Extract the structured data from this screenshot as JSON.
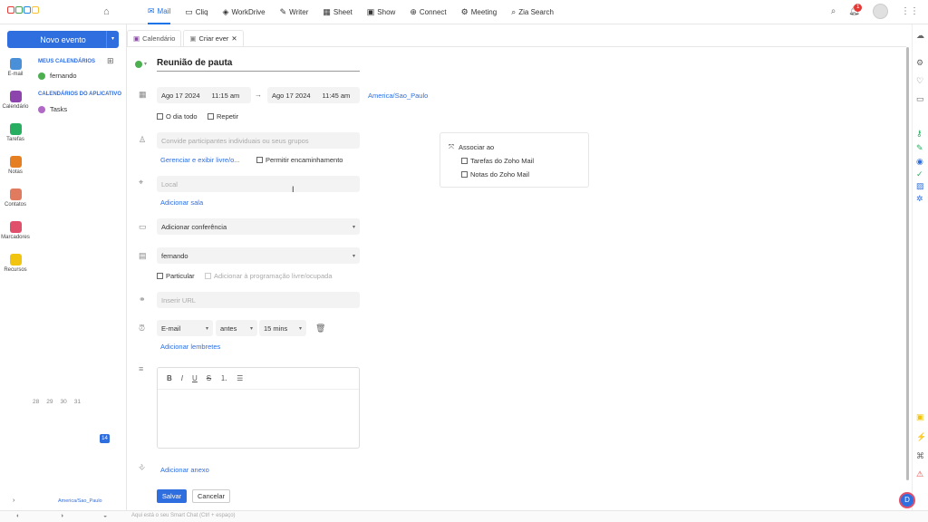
{
  "topbar": {
    "apps": [
      {
        "label": "Mail",
        "icon": "mail-icon",
        "active": true
      },
      {
        "label": "Cliq",
        "icon": "chat-icon"
      },
      {
        "label": "WorkDrive",
        "icon": "drive-icon"
      },
      {
        "label": "Writer",
        "icon": "writer-icon"
      },
      {
        "label": "Sheet",
        "icon": "sheet-icon"
      },
      {
        "label": "Show",
        "icon": "show-icon"
      },
      {
        "label": "Connect",
        "icon": "connect-icon"
      },
      {
        "label": "Meeting",
        "icon": "meeting-icon"
      },
      {
        "label": "Zia Search",
        "icon": "zia-search-icon"
      }
    ],
    "notification_count": "1"
  },
  "leftrail": [
    {
      "label": "E-mail",
      "color": "#4a90d9"
    },
    {
      "label": "Calendário",
      "color": "#8e44ad"
    },
    {
      "label": "Tarefas",
      "color": "#27ae60"
    },
    {
      "label": "Notas",
      "color": "#e67e22"
    },
    {
      "label": "Contatos",
      "color": "#e07b5f"
    },
    {
      "label": "Marcadores",
      "color": "#e0506b"
    },
    {
      "label": "Recursos",
      "color": "#f1c40f"
    }
  ],
  "sidebar": {
    "new_event": "Novo evento",
    "my_calendars_title": "MEUS CALENDÁRIOS",
    "my_calendars": [
      {
        "label": "fernando",
        "color": "#4caf50"
      }
    ],
    "app_calendars_title": "CALENDÁRIOS DO APLICATIVO",
    "app_calendars": [
      {
        "label": "Tasks",
        "color": "#b06ac6"
      }
    ],
    "mini_calendar_row": [
      "28",
      "29",
      "30",
      "31"
    ],
    "mini_calendar_today": "14",
    "timezone": "America/Sao_Paulo"
  },
  "tabs": [
    {
      "label": "Calendário"
    },
    {
      "label": "Criar ever"
    }
  ],
  "form": {
    "title": "Reunião de pauta",
    "start_date": "Ago 17 2024",
    "start_time": "11:15 am",
    "end_date": "Ago 17 2024",
    "end_time": "11:45 am",
    "timezone": "America/Sao_Paulo",
    "all_day": "O dia todo",
    "repeat": "Repetir",
    "invite_placeholder": "Convide participantes individuais ou seus grupos",
    "manage_link": "Gerenciar e exibir livre/o...",
    "allow_forward": "Permitir encaminhamento",
    "location_placeholder": "Local",
    "add_room": "Adicionar sala",
    "conference": "Adicionar conferência",
    "calendar": "fernando",
    "private": "Particular",
    "add_to_schedule": "Adicionar à programação livre/ocupada",
    "url_placeholder": "Inserir URL",
    "reminder_type": "E-mail",
    "reminder_when": "antes",
    "reminder_time": "15 mins",
    "add_reminders": "Adicionar lembretes",
    "add_attachment": "Adicionar anexo",
    "save": "Salvar",
    "cancel": "Cancelar"
  },
  "associate": {
    "title": "Associar ao",
    "items": [
      "Tarefas do Zoho Mail",
      "Notas do Zoho Mail"
    ]
  },
  "bottombar": {
    "chat_placeholder": "Aqui está o seu Smart Chat (Ctrl + espaço)"
  },
  "colors": {
    "accent": "#2f6ede"
  }
}
